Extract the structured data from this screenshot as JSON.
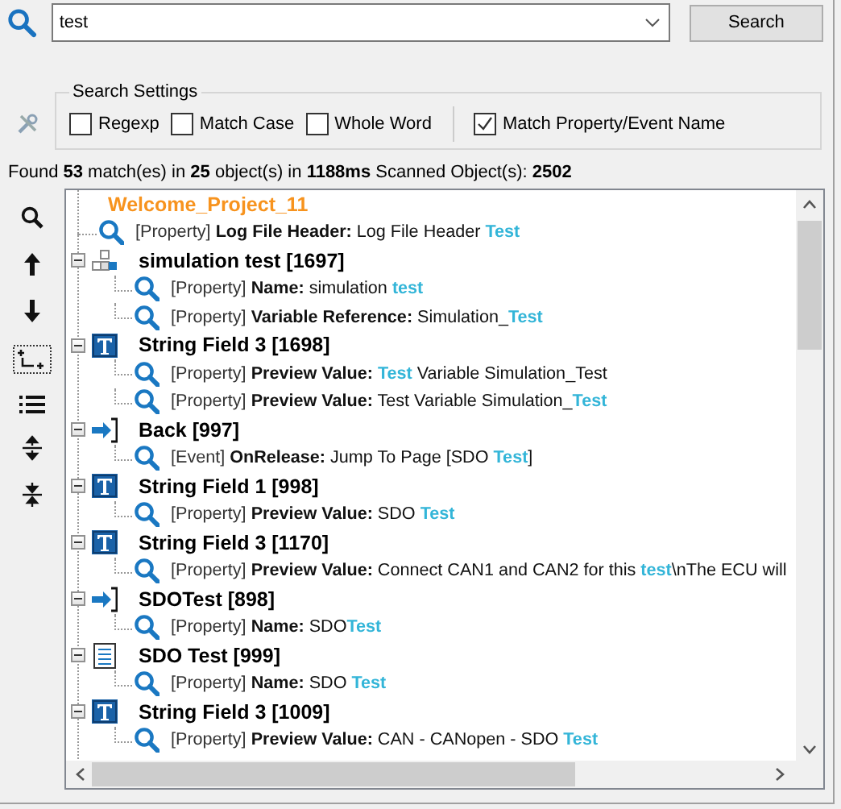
{
  "search": {
    "value": "test",
    "button": "Search"
  },
  "settings": {
    "title": "Search Settings",
    "options": [
      {
        "label": "Regexp",
        "checked": false
      },
      {
        "label": "Match Case",
        "checked": false
      },
      {
        "label": "Whole Word",
        "checked": false
      },
      {
        "label": "Match Property/Event Name",
        "checked": true
      }
    ]
  },
  "status": "Found **53** match(es) in **25** object(s) in **1188ms** Scanned Object(s): **2502**",
  "tree": {
    "root": "Welcome_Project_11",
    "children": [
      {
        "kind": "match",
        "tag": "[Property]",
        "name": "Log File Header:",
        "value": "Log File Header **Test**"
      },
      {
        "kind": "variable",
        "label": "simulation test [1697]",
        "expanded": true,
        "children": [
          {
            "kind": "match",
            "tag": "[Property]",
            "name": "Name:",
            "value": "simulation **test**"
          },
          {
            "kind": "match",
            "tag": "[Property]",
            "name": "Variable Reference:",
            "value": "Simulation_**Test**"
          }
        ]
      },
      {
        "kind": "text",
        "label": "String Field 3 [1698]",
        "expanded": true,
        "children": [
          {
            "kind": "match",
            "tag": "[Property]",
            "name": "Preview Value:",
            "value": "**Test** Variable Simulation_Test"
          },
          {
            "kind": "match",
            "tag": "[Property]",
            "name": "Preview Value:",
            "value": "Test Variable Simulation_**Test**"
          }
        ]
      },
      {
        "kind": "link",
        "label": "Back [997]",
        "expanded": true,
        "children": [
          {
            "kind": "match",
            "tag": "[Event]",
            "name": "OnRelease:",
            "value": "Jump To Page [SDO **Test**]"
          }
        ]
      },
      {
        "kind": "text",
        "label": "String Field 1 [998]",
        "expanded": true,
        "children": [
          {
            "kind": "match",
            "tag": "[Property]",
            "name": "Preview Value:",
            "value": "SDO **Test**"
          }
        ]
      },
      {
        "kind": "text",
        "label": "String Field 3 [1170]",
        "expanded": true,
        "children": [
          {
            "kind": "match",
            "tag": "[Property]",
            "name": "Preview Value:",
            "value": "Connect CAN1 and CAN2 for this **test**\\nThe ECU will"
          }
        ]
      },
      {
        "kind": "link",
        "label": "SDOTest [898]",
        "expanded": true,
        "children": [
          {
            "kind": "match",
            "tag": "[Property]",
            "name": "Name:",
            "value": "SDO**Test**"
          }
        ]
      },
      {
        "kind": "list",
        "label": "SDO Test [999]",
        "expanded": true,
        "children": [
          {
            "kind": "match",
            "tag": "[Property]",
            "name": "Name:",
            "value": "SDO **Test**"
          }
        ]
      },
      {
        "kind": "text",
        "label": "String Field 3 [1009]",
        "expanded": true,
        "children": [
          {
            "kind": "match",
            "tag": "[Property]",
            "name": "Preview Value:",
            "value": "CAN - CANopen - SDO **Test**"
          }
        ]
      }
    ]
  }
}
